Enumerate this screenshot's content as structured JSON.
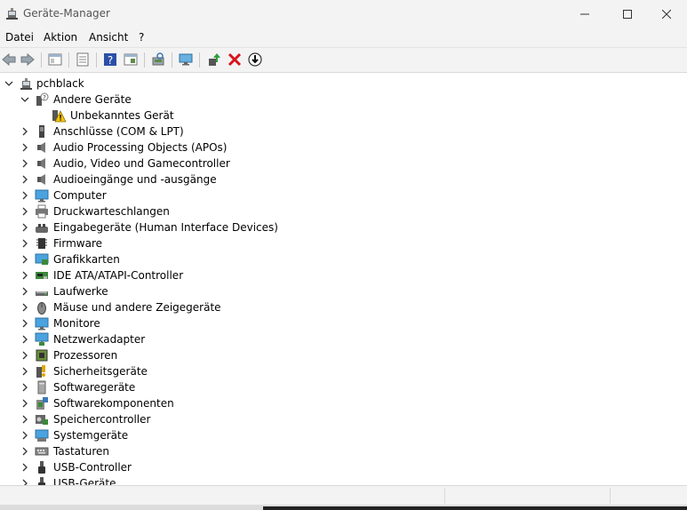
{
  "window": {
    "title": "Geräte-Manager"
  },
  "menu": [
    "Datei",
    "Aktion",
    "Ansicht",
    "?"
  ],
  "toolbar": [
    "back-arrow-icon",
    "forward-arrow-icon",
    "properties-pane-icon",
    "device-list-icon",
    "help-icon",
    "view-icon",
    "scan-hardware-icon",
    "monitor-icon",
    "update-driver-icon",
    "uninstall-icon",
    "download-driver-icon"
  ],
  "tree": {
    "root": "pchblack",
    "open_category": "Andere Geräte",
    "child": "Unbekanntes Gerät",
    "categories": [
      "Anschlüsse (COM & LPT)",
      "Audio Processing Objects (APOs)",
      "Audio, Video und Gamecontroller",
      "Audioeingänge und -ausgänge",
      "Computer",
      "Druckwarteschlangen",
      "Eingabegeräte (Human Interface Devices)",
      "Firmware",
      "Grafikkarten",
      "IDE ATA/ATAPI-Controller",
      "Laufwerke",
      "Mäuse und andere Zeigegeräte",
      "Monitore",
      "Netzwerkadapter",
      "Prozessoren",
      "Sicherheitsgeräte",
      "Softwaregeräte",
      "Softwarekomponenten",
      "Speichercontroller",
      "Systemgeräte",
      "Tastaturen",
      "USB-Controller",
      "USB-Geräte"
    ]
  }
}
